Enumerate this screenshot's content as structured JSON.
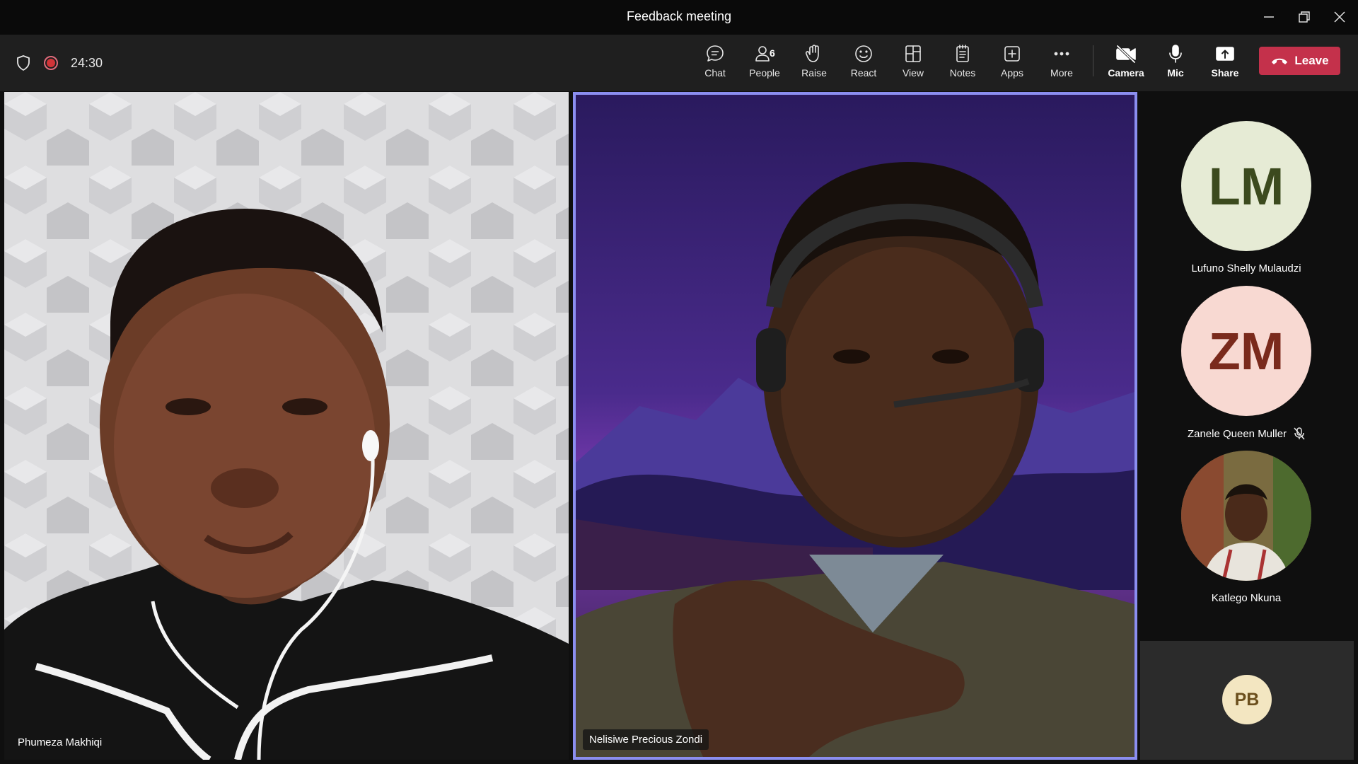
{
  "window": {
    "title": "Feedback meeting"
  },
  "meeting": {
    "timer": "24:30"
  },
  "toolbar": {
    "chat": "Chat",
    "people": "People",
    "people_count": "6",
    "raise": "Raise",
    "react": "React",
    "view": "View",
    "notes": "Notes",
    "apps": "Apps",
    "more": "More",
    "camera": "Camera",
    "mic": "Mic",
    "share": "Share",
    "leave": "Leave"
  },
  "tiles": [
    {
      "name": "Phumeza Makhiqi"
    },
    {
      "name": "Nelisiwe Precious Zondi"
    }
  ],
  "roster": [
    {
      "initials": "LM",
      "name": "Lufuno Shelly Mulaudzi",
      "bg": "#e6ebd5",
      "fg": "#3c4a1e",
      "muted": false
    },
    {
      "initials": "ZM",
      "name": "Zanele Queen Muller",
      "bg": "#f8d9d2",
      "fg": "#7a2a1c",
      "muted": true
    },
    {
      "initials": "",
      "name": "Katlego Nkuna",
      "muted": false
    }
  ],
  "overflow_tile": {
    "initials": "PB"
  },
  "colors": {
    "leave": "#c4314b",
    "active_speaker_border": "#8b8ef0",
    "recording": "#d13438"
  }
}
